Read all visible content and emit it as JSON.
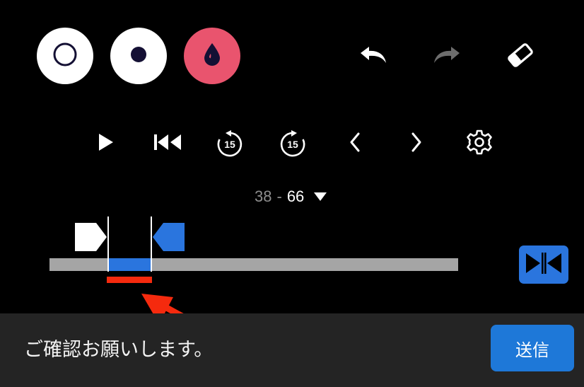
{
  "colors": {
    "background": "#000000",
    "accent_blue": "#2a75de",
    "drop_pink": "#e9546e",
    "annotation_red": "#f52a0e",
    "footer_bg": "#242424",
    "send_blue": "#1e78d8"
  },
  "toolbar": {
    "tools": [
      {
        "name": "outline-circle-tool",
        "icon": "ring-icon"
      },
      {
        "name": "dot-tool",
        "icon": "dot-icon"
      },
      {
        "name": "fill-tool",
        "icon": "drop-icon"
      }
    ],
    "actions": [
      "undo-icon",
      "redo-icon",
      "eraser-icon"
    ]
  },
  "player": {
    "controls": [
      "play-icon",
      "skip-to-start-icon",
      "rewind-15-icon",
      "forward-15-icon",
      "chevron-left-icon",
      "chevron-right-icon",
      "gear-icon"
    ],
    "rewind_label": "15",
    "forward_label": "15"
  },
  "range": {
    "start": "38",
    "separator": "-",
    "end": "66"
  },
  "footer": {
    "message": "ご確認お願いします。",
    "send_label": "送信"
  }
}
